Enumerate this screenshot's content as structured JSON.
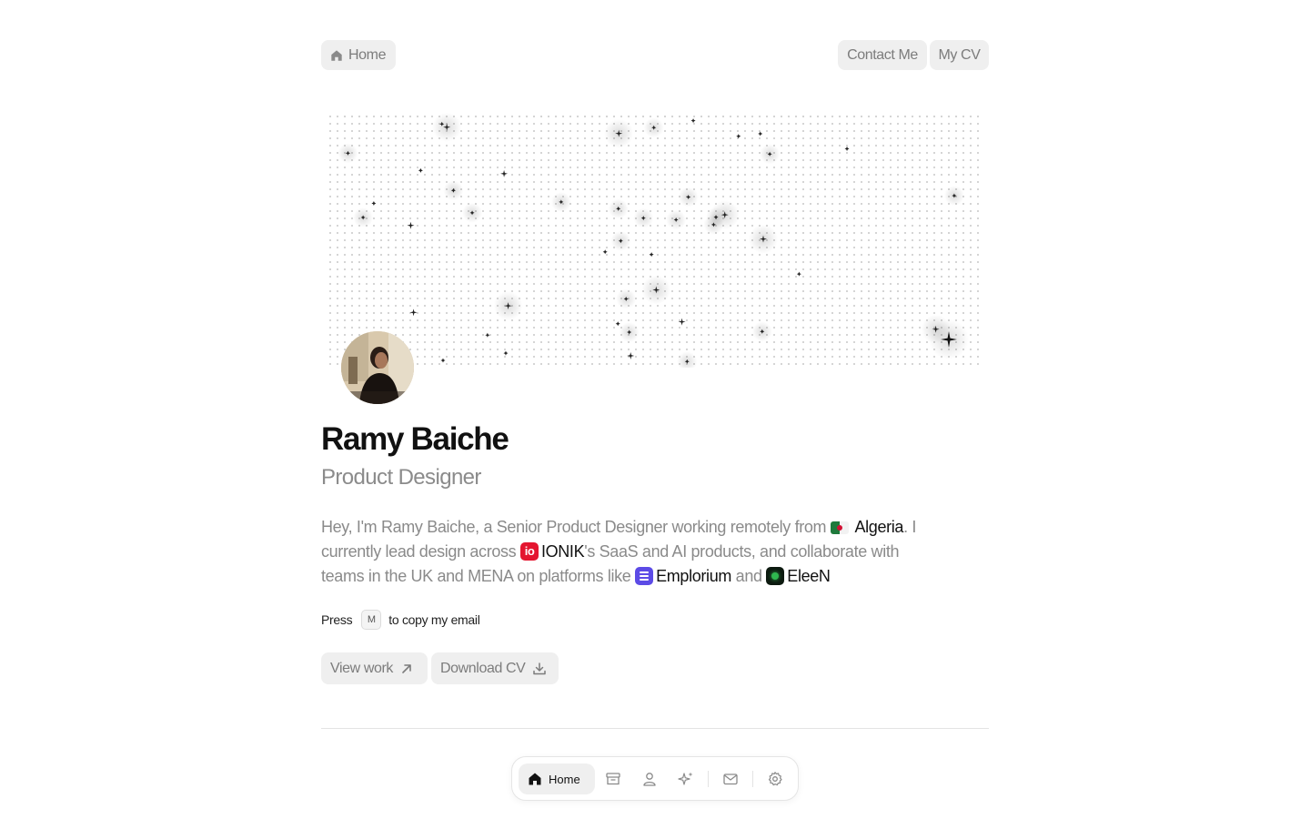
{
  "topnav": {
    "home_label": "Home",
    "contact_label": "Contact Me",
    "cv_label": "My CV"
  },
  "profile": {
    "name": "Ramy Baiche",
    "role": "Product Designer"
  },
  "bio": {
    "p1": "Hey, I'm Ramy Baiche, a Senior Product Designer working remotely from",
    "algeria": "Algeria",
    "p2": ". I currently lead design across",
    "ionik_badge": "io",
    "ionik": "IONIK",
    "p3": "'s SaaS and AI products, and collaborate with teams in the UK and MENA on platforms like",
    "emplorium": "Emplorium",
    "and": "and",
    "eleen": "EleeN"
  },
  "hint": {
    "press": "Press",
    "key": "M",
    "rest": "to copy my email"
  },
  "actions": {
    "view_work": "View work",
    "download_cv": "Download CV"
  },
  "dock": {
    "home_label": "Home",
    "icons": [
      "archive-icon",
      "user-icon",
      "sparkles-icon",
      "mail-icon",
      "gear-icon"
    ]
  },
  "colors": {
    "text": "#111111",
    "muted": "#8a8a8a",
    "pill_bg": "#efefef",
    "ionik": "#e4152f",
    "emplorium": "#5c4be6",
    "eleen": "#2fb84f"
  }
}
